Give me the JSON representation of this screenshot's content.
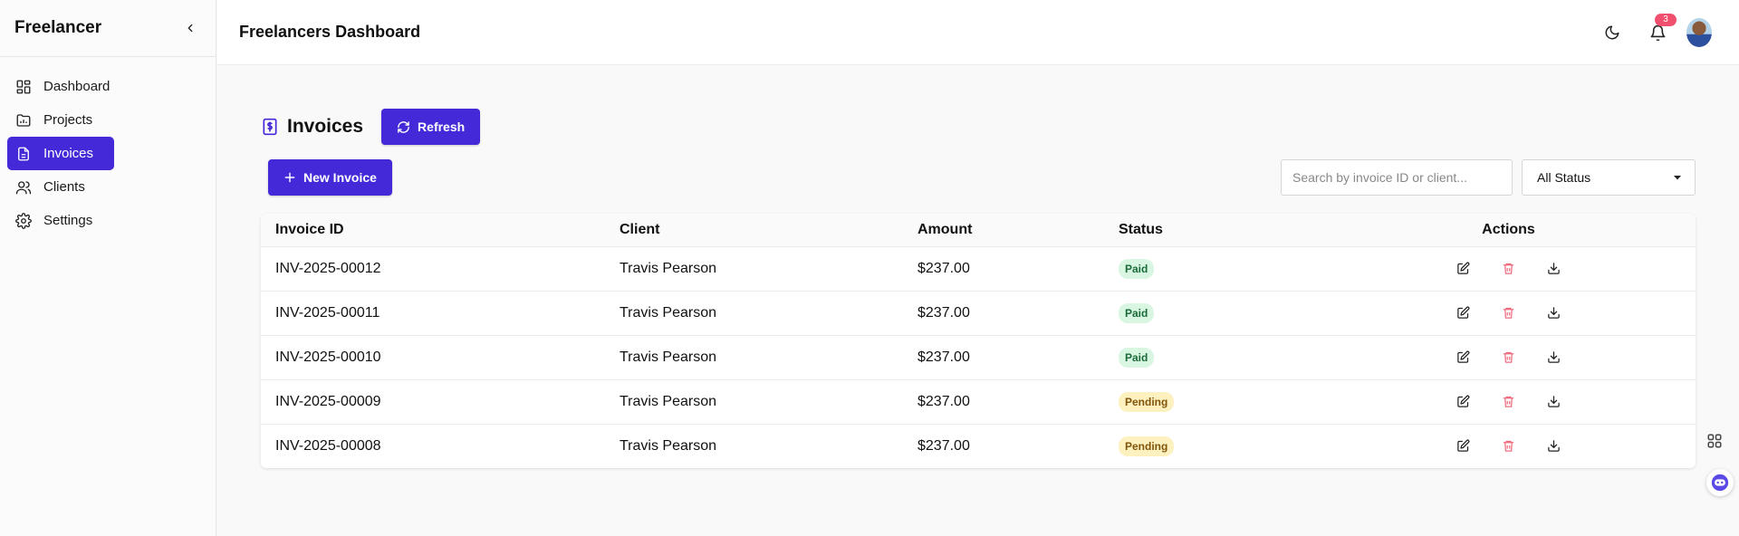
{
  "sidebar": {
    "brand": "Freelancer",
    "items": [
      {
        "label": "Dashboard",
        "icon": "dashboard-icon"
      },
      {
        "label": "Projects",
        "icon": "projects-icon"
      },
      {
        "label": "Invoices",
        "icon": "invoice-icon",
        "active": true
      },
      {
        "label": "Clients",
        "icon": "clients-icon"
      },
      {
        "label": "Settings",
        "icon": "gear-icon"
      }
    ]
  },
  "header": {
    "title": "Freelancers Dashboard",
    "notifications_count": "3"
  },
  "main": {
    "title": "Invoices",
    "refresh_label": "Refresh",
    "new_invoice_label": "New Invoice",
    "search_placeholder": "Search by invoice ID or client...",
    "status_filter": "All Status",
    "columns": [
      "Invoice ID",
      "Client",
      "Amount",
      "Status",
      "Actions"
    ],
    "rows": [
      {
        "id": "INV-2025-00012",
        "client": "Travis Pearson",
        "amount": "$237.00",
        "status": "Paid"
      },
      {
        "id": "INV-2025-00011",
        "client": "Travis Pearson",
        "amount": "$237.00",
        "status": "Paid"
      },
      {
        "id": "INV-2025-00010",
        "client": "Travis Pearson",
        "amount": "$237.00",
        "status": "Paid"
      },
      {
        "id": "INV-2025-00009",
        "client": "Travis Pearson",
        "amount": "$237.00",
        "status": "Pending"
      },
      {
        "id": "INV-2025-00008",
        "client": "Travis Pearson",
        "amount": "$237.00",
        "status": "Pending"
      }
    ]
  },
  "colors": {
    "accent": "#4329d8",
    "paid_bg": "#d9f6e2",
    "pending_bg": "#fdf1bf",
    "delete": "#f06a7e",
    "badge": "#f0506e"
  }
}
